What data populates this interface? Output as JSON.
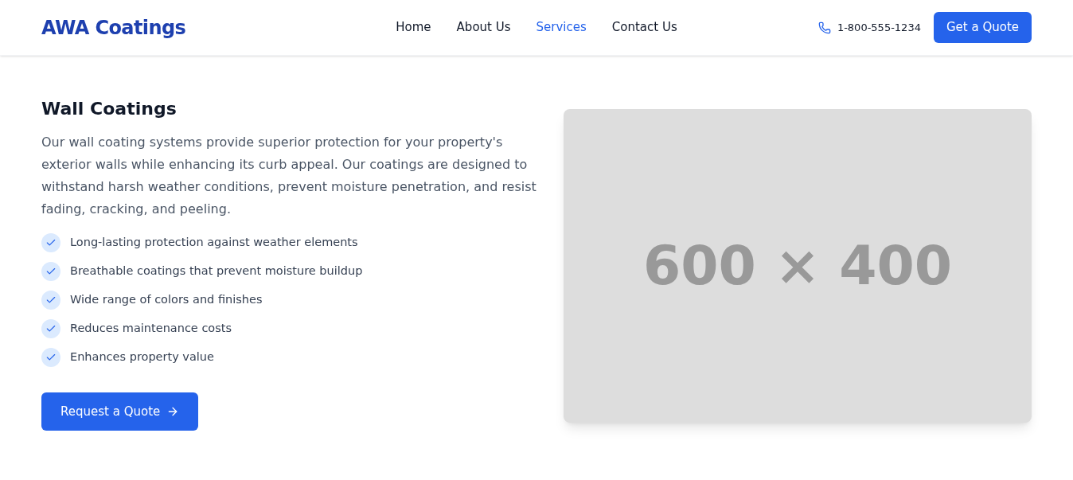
{
  "header": {
    "logo": "AWA Coatings",
    "nav": [
      {
        "label": "Home",
        "selected": false
      },
      {
        "label": "About Us",
        "selected": false
      },
      {
        "label": "Services",
        "selected": true
      },
      {
        "label": "Contact Us",
        "selected": false
      }
    ],
    "phone": "1-800-555-1234",
    "cta": "Get a Quote"
  },
  "section": {
    "title": "Wall Coatings",
    "description": "Our wall coating systems provide superior protection for your property's exterior walls while enhancing its curb appeal. Our coatings are designed to withstand harsh weather conditions, prevent moisture penetration, and resist fading, cracking, and peeling.",
    "features": [
      "Long-lasting protection against weather elements",
      "Breathable coatings that prevent moisture buildup",
      "Wide range of colors and finishes",
      "Reduces maintenance costs",
      "Enhances property value"
    ],
    "button": "Request a Quote",
    "image_placeholder": "600 × 400"
  }
}
